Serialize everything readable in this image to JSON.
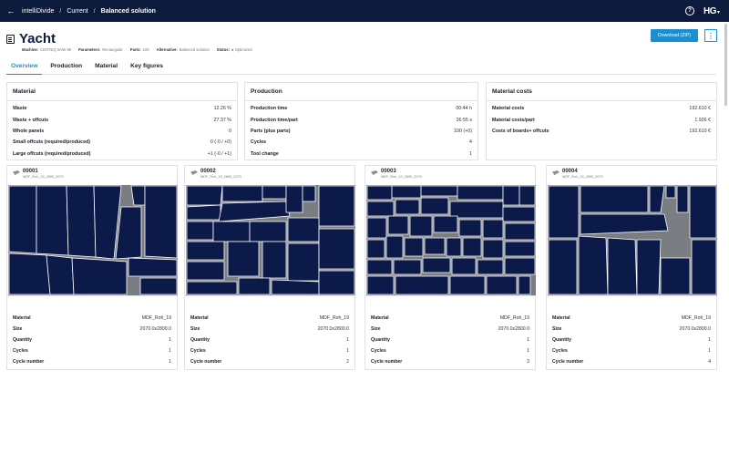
{
  "topbar": {
    "crumbs": [
      "intelliDivide",
      "Current",
      "Balanced solution"
    ],
    "separator": "/",
    "logo": "HG"
  },
  "header": {
    "title": "Yacht",
    "meta": [
      {
        "label": "Machine:",
        "value": "CENTEQ SAW 99"
      },
      {
        "label": "Parameters:",
        "value": "Rectangular"
      },
      {
        "label": "Parts:",
        "value": "100"
      },
      {
        "label": "Alternative:",
        "value": "Balanced solution"
      },
      {
        "label": "Status:",
        "value": "Optimized"
      }
    ],
    "download_label": "Download (ZIP)",
    "more_label": "⋮"
  },
  "tabs": [
    {
      "label": "Overview",
      "active": true
    },
    {
      "label": "Production",
      "active": false
    },
    {
      "label": "Material",
      "active": false
    },
    {
      "label": "Key figures",
      "active": false
    }
  ],
  "material": {
    "title": "Material",
    "rows": [
      {
        "k": "Waste",
        "v": "12.26 %"
      },
      {
        "k": "Waste + offcuts",
        "v": "27.37 %"
      },
      {
        "k": "Whole panels",
        "v": "0"
      },
      {
        "k": "Small offcuts (required/produced)",
        "v": "0 (-0 / +0)"
      },
      {
        "k": "Large offcuts (required/produced)",
        "v": "+1 (-0 / +1)"
      }
    ]
  },
  "production": {
    "title": "Production",
    "rows": [
      {
        "k": "Production time",
        "v": "00:44 h"
      },
      {
        "k": "Production time/part",
        "v": "26:55 s"
      },
      {
        "k": "Parts (plus parts)",
        "v": "100 (+0)"
      },
      {
        "k": "Cycles",
        "v": "4"
      },
      {
        "k": "Tool change",
        "v": "1"
      }
    ]
  },
  "costs": {
    "title": "Material costs",
    "rows": [
      {
        "k": "Material costs",
        "v": "192.610 €"
      },
      {
        "k": "Material costs/part",
        "v": "1.926 €"
      },
      {
        "k": "Costs of boards+ offcuts",
        "v": "192.610 €"
      }
    ]
  },
  "patterns": [
    {
      "name": "00001",
      "sub": "MDF_Roh_19_2800_2070",
      "rows": [
        {
          "k": "Material",
          "v": "MDF_Roh_19"
        },
        {
          "k": "Size",
          "v": "2070.0x2800.0"
        },
        {
          "k": "Quantity",
          "v": "1"
        },
        {
          "k": "Cycles",
          "v": "1"
        },
        {
          "k": "Cycle number",
          "v": "1"
        }
      ]
    },
    {
      "name": "00002",
      "sub": "MDF_Roh_19_2800_2070",
      "rows": [
        {
          "k": "Material",
          "v": "MDF_Roh_19"
        },
        {
          "k": "Size",
          "v": "2070.0x2800.0"
        },
        {
          "k": "Quantity",
          "v": "1"
        },
        {
          "k": "Cycles",
          "v": "1"
        },
        {
          "k": "Cycle number",
          "v": "2"
        }
      ]
    },
    {
      "name": "00003",
      "sub": "MDF_Roh_19_2800_2070",
      "rows": [
        {
          "k": "Material",
          "v": "MDF_Roh_19"
        },
        {
          "k": "Size",
          "v": "2070.0x2800.0"
        },
        {
          "k": "Quantity",
          "v": "1"
        },
        {
          "k": "Cycles",
          "v": "1"
        },
        {
          "k": "Cycle number",
          "v": "3"
        }
      ]
    },
    {
      "name": "00004",
      "sub": "MDF_Roh_19_2800_2070",
      "rows": [
        {
          "k": "Material",
          "v": "MDF_Roh_19"
        },
        {
          "k": "Size",
          "v": "2070.0x2800.0"
        },
        {
          "k": "Quantity",
          "v": "1"
        },
        {
          "k": "Cycles",
          "v": "1"
        },
        {
          "k": "Cycle number",
          "v": "4"
        }
      ]
    }
  ],
  "colors": {
    "nav": "#0c1a3b",
    "accent": "#1a8fd0",
    "part": "#0c1a4a",
    "waste": "#7a7d82"
  }
}
